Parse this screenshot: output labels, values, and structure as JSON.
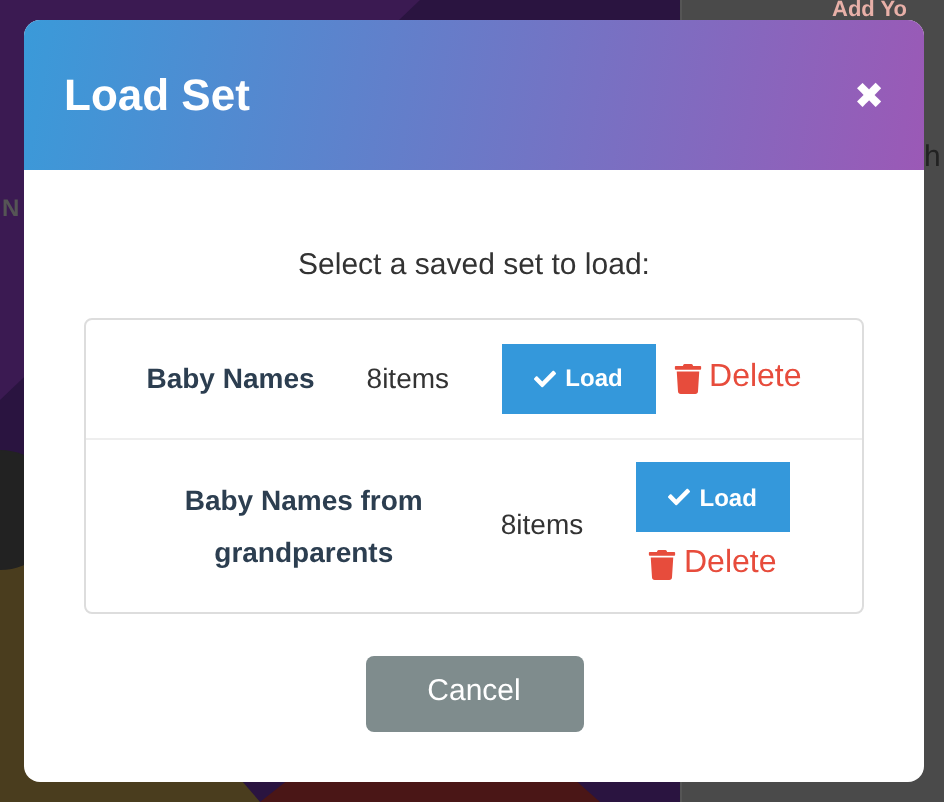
{
  "background": {
    "heading": "Add Yo",
    "fragment_right": "h",
    "fragment_left": "N"
  },
  "dialog": {
    "title": "Load Set",
    "close": "✖",
    "prompt": "Select a saved set to load:",
    "sets": [
      {
        "name": "Baby Names",
        "count": "8items",
        "load": "Load",
        "delete": "Delete"
      },
      {
        "name": "Baby Names from grandparents",
        "count": "8items",
        "load": "Load",
        "delete": "Delete"
      }
    ],
    "cancel": "Cancel"
  }
}
